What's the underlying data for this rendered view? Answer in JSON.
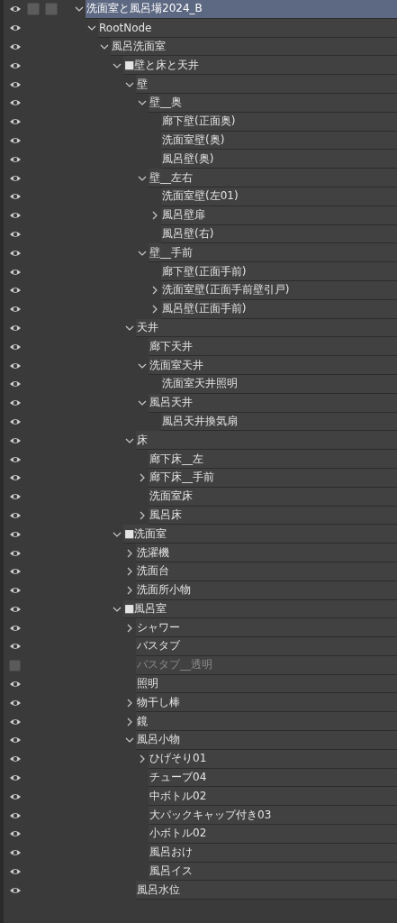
{
  "layers": [
    {
      "label": "洗面室と風呂場2024_B",
      "visible": true,
      "selected": true,
      "expanded": true,
      "children": [
        {
          "label": "RootNode",
          "visible": true,
          "selected": false,
          "expanded": true,
          "children": [
            {
              "label": "風呂洗面室",
              "visible": true,
              "selected": false,
              "expanded": true,
              "children": [
                {
                  "label": "■壁と床と天井",
                  "visible": true,
                  "selected": false,
                  "expanded": true,
                  "children": [
                    {
                      "label": "壁",
                      "visible": true,
                      "selected": false,
                      "expanded": true,
                      "children": [
                        {
                          "label": "壁__奥",
                          "visible": true,
                          "selected": false,
                          "expanded": true,
                          "children": [
                            {
                              "label": "廊下壁(正面奥)",
                              "visible": true,
                              "selected": false
                            },
                            {
                              "label": "洗面室壁(奥)",
                              "visible": true,
                              "selected": false
                            },
                            {
                              "label": "風呂壁(奥)",
                              "visible": true,
                              "selected": false
                            }
                          ]
                        },
                        {
                          "label": "壁__左右",
                          "visible": true,
                          "selected": false,
                          "expanded": true,
                          "children": [
                            {
                              "label": "洗面室壁(左01)",
                              "visible": true,
                              "selected": false
                            },
                            {
                              "label": "風呂壁扉",
                              "visible": true,
                              "selected": false,
                              "expanded": false
                            },
                            {
                              "label": "風呂壁(右)",
                              "visible": true,
                              "selected": false
                            }
                          ]
                        },
                        {
                          "label": "壁__手前",
                          "visible": true,
                          "selected": false,
                          "expanded": true,
                          "children": [
                            {
                              "label": "廊下壁(正面手前)",
                              "visible": true,
                              "selected": false
                            },
                            {
                              "label": "洗面室壁(正面手前壁引戸)",
                              "visible": true,
                              "selected": false,
                              "expanded": false
                            },
                            {
                              "label": "風呂壁(正面手前)",
                              "visible": true,
                              "selected": false,
                              "expanded": false
                            }
                          ]
                        }
                      ]
                    },
                    {
                      "label": "天井",
                      "visible": true,
                      "selected": false,
                      "expanded": true,
                      "children": [
                        {
                          "label": "廊下天井",
                          "visible": true,
                          "selected": false
                        },
                        {
                          "label": "洗面室天井",
                          "visible": true,
                          "selected": false,
                          "expanded": true,
                          "children": [
                            {
                              "label": "洗面室天井照明",
                              "visible": true,
                              "selected": false
                            }
                          ]
                        },
                        {
                          "label": "風呂天井",
                          "visible": true,
                          "selected": false,
                          "expanded": true,
                          "children": [
                            {
                              "label": "風呂天井換気扇",
                              "visible": true,
                              "selected": false
                            }
                          ]
                        }
                      ]
                    },
                    {
                      "label": "床",
                      "visible": true,
                      "selected": false,
                      "expanded": true,
                      "children": [
                        {
                          "label": "廊下床__左",
                          "visible": true,
                          "selected": false
                        },
                        {
                          "label": "廊下床__手前",
                          "visible": true,
                          "selected": false,
                          "expanded": false
                        },
                        {
                          "label": "洗面室床",
                          "visible": true,
                          "selected": false
                        },
                        {
                          "label": "風呂床",
                          "visible": true,
                          "selected": false,
                          "expanded": false
                        }
                      ]
                    }
                  ]
                },
                {
                  "label": "■洗面室",
                  "visible": true,
                  "selected": false,
                  "expanded": true,
                  "children": [
                    {
                      "label": "洗濯機",
                      "visible": true,
                      "selected": false,
                      "expanded": false
                    },
                    {
                      "label": "洗面台",
                      "visible": true,
                      "selected": false,
                      "expanded": false
                    },
                    {
                      "label": "洗面所小物",
                      "visible": true,
                      "selected": false,
                      "expanded": false
                    }
                  ]
                },
                {
                  "label": "■風呂室",
                  "visible": true,
                  "selected": false,
                  "expanded": true,
                  "children": [
                    {
                      "label": "シャワー",
                      "visible": true,
                      "selected": false,
                      "expanded": false
                    },
                    {
                      "label": "バスタブ",
                      "visible": true,
                      "selected": false
                    },
                    {
                      "label": "バスタブ__透明",
                      "visible": false,
                      "selected": false
                    },
                    {
                      "label": "照明",
                      "visible": true,
                      "selected": false
                    },
                    {
                      "label": "物干し棒",
                      "visible": true,
                      "selected": false,
                      "expanded": false
                    },
                    {
                      "label": "鏡",
                      "visible": true,
                      "selected": false,
                      "expanded": false
                    },
                    {
                      "label": "風呂小物",
                      "visible": true,
                      "selected": false,
                      "expanded": true,
                      "children": [
                        {
                          "label": "ひげそり01",
                          "visible": true,
                          "selected": false,
                          "expanded": false
                        },
                        {
                          "label": "チューブ04",
                          "visible": true,
                          "selected": false
                        },
                        {
                          "label": "中ボトル02",
                          "visible": true,
                          "selected": false
                        },
                        {
                          "label": "大パックキャップ付き03",
                          "visible": true,
                          "selected": false
                        },
                        {
                          "label": "小ボトル02",
                          "visible": true,
                          "selected": false
                        },
                        {
                          "label": "風呂おけ",
                          "visible": true,
                          "selected": false
                        },
                        {
                          "label": "風呂イス",
                          "visible": true,
                          "selected": false
                        }
                      ]
                    },
                    {
                      "label": "風呂水位",
                      "visible": true,
                      "selected": false
                    }
                  ]
                }
              ]
            }
          ]
        }
      ]
    }
  ]
}
